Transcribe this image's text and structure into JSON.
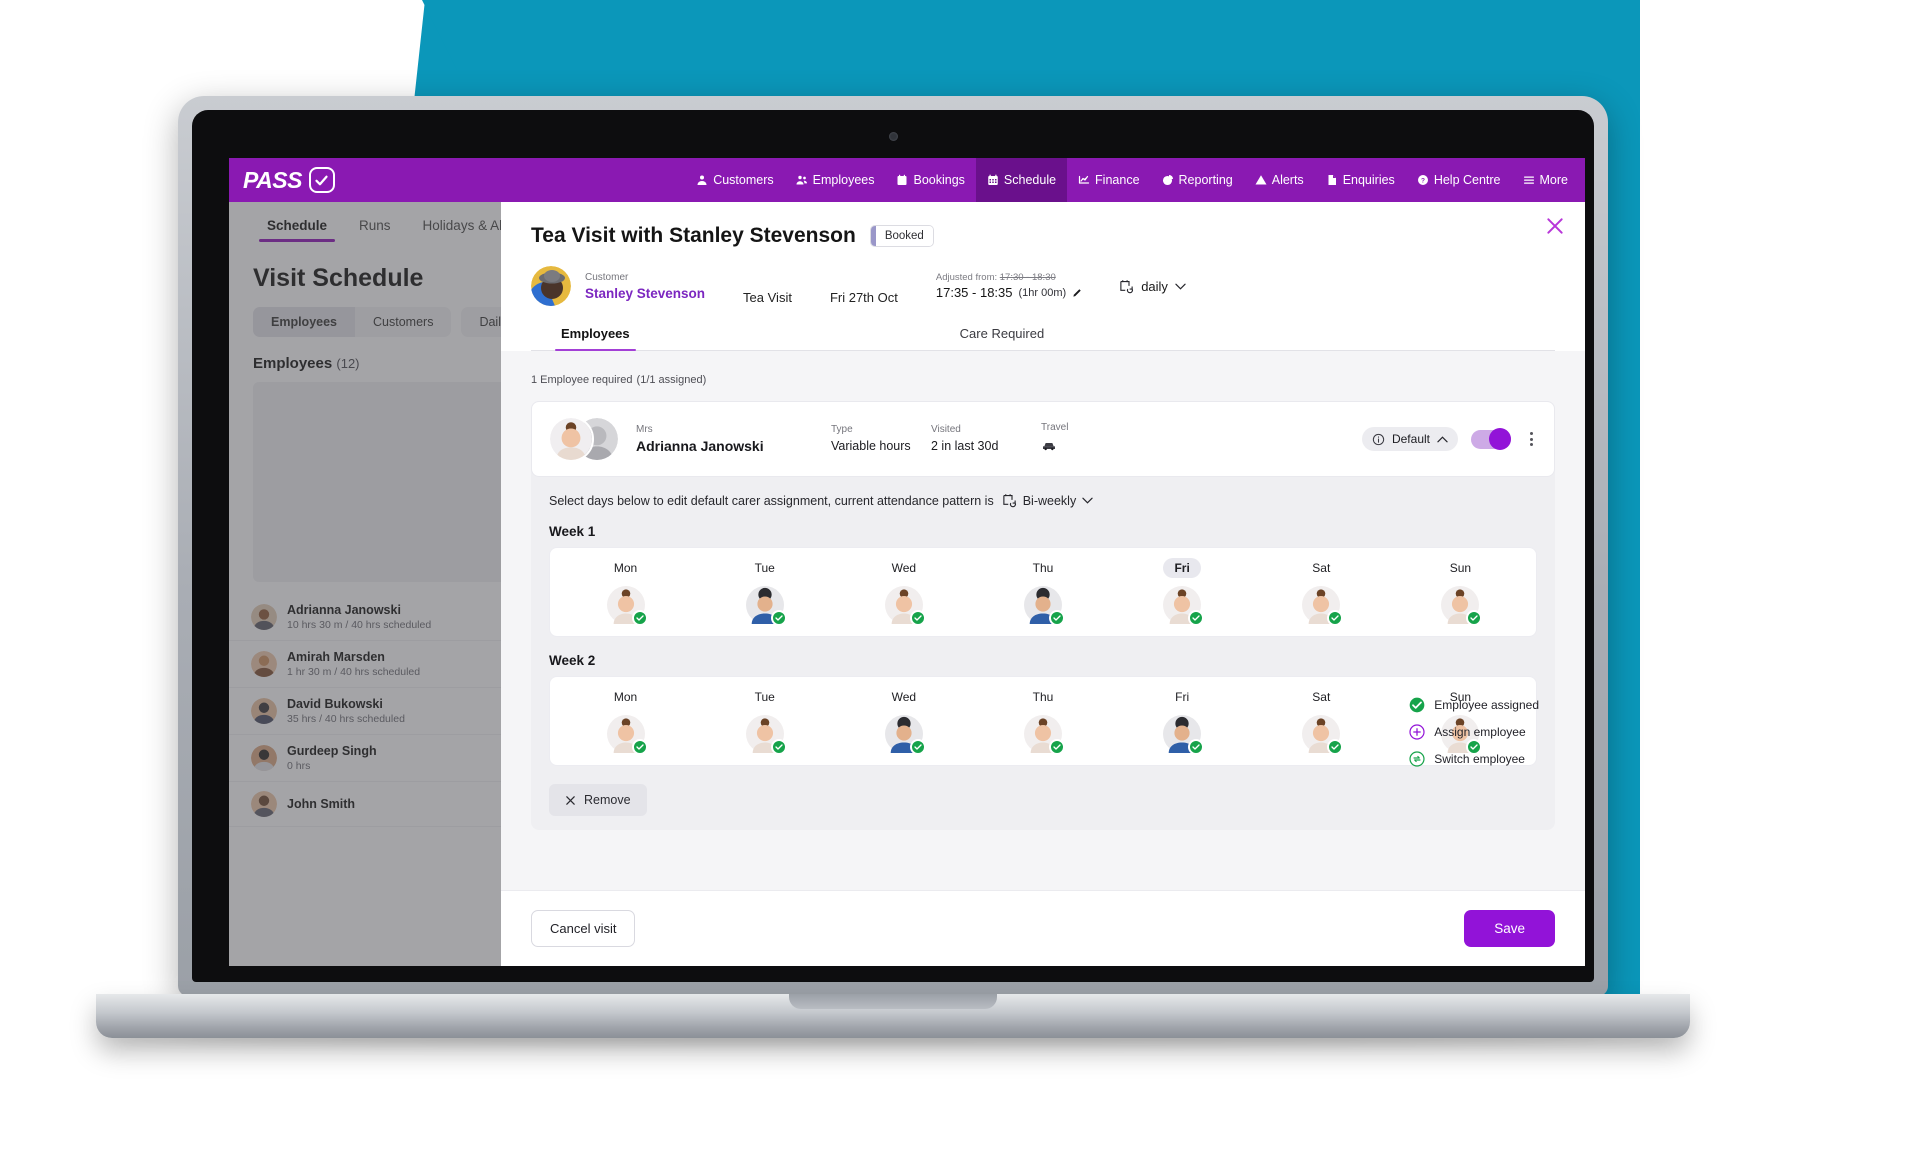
{
  "nav": {
    "logo_text": "PASS",
    "items": [
      {
        "label": "Customers",
        "icon": "user-icon",
        "active": false
      },
      {
        "label": "Employees",
        "icon": "users-icon",
        "active": false
      },
      {
        "label": "Bookings",
        "icon": "calendar-icon",
        "active": false
      },
      {
        "label": "Schedule",
        "icon": "grid-calendar-icon",
        "active": true
      },
      {
        "label": "Finance",
        "icon": "chart-line-icon",
        "active": false
      },
      {
        "label": "Reporting",
        "icon": "pie-chart-icon",
        "active": false
      },
      {
        "label": "Alerts",
        "icon": "warning-triangle-icon",
        "active": false
      },
      {
        "label": "Enquiries",
        "icon": "document-icon",
        "active": false
      },
      {
        "label": "Help Centre",
        "icon": "question-circle-icon",
        "active": false
      },
      {
        "label": "More",
        "icon": "hamburger-icon",
        "active": false
      }
    ]
  },
  "background_app": {
    "subtabs": [
      {
        "label": "Schedule",
        "active": true
      },
      {
        "label": "Runs",
        "active": false
      },
      {
        "label": "Holidays & Ab",
        "active": false
      }
    ],
    "page_title": "Visit Schedule",
    "filters": [
      {
        "label": "Employees",
        "on": true
      },
      {
        "label": "Customers",
        "on": false
      }
    ],
    "filter_extra": "Dail",
    "employees_heading": "Employees",
    "employees_count": "(12)",
    "employee_rows": [
      {
        "name": "Adrianna Janowski",
        "detail": "10 hrs 30 m / 40 hrs scheduled",
        "warning": false
      },
      {
        "name": "Amirah Marsden",
        "detail": "1 hr 30 m / 40 hrs scheduled",
        "warning": false
      },
      {
        "name": "David Bukowski",
        "detail": "35 hrs / 40 hrs scheduled",
        "warning": false
      },
      {
        "name": "Gurdeep Singh",
        "detail": "0 hrs",
        "warning": true
      },
      {
        "name": "John Smith",
        "detail": "",
        "warning": false
      }
    ]
  },
  "modal": {
    "close_icon": "close-icon",
    "title": "Tea Visit with Stanley Stevenson",
    "status_badge": "Booked",
    "customer": {
      "label": "Customer",
      "name": "Stanley Stevenson",
      "visit_type": "Tea Visit",
      "date": "Fri 27th Oct"
    },
    "adjusted": {
      "prefix": "Adjusted from:",
      "original": "17:30 - 18:30",
      "current": "17:35 - 18:35",
      "duration": "(1hr 00m)",
      "edit_icon": "pencil-icon"
    },
    "recurrence": {
      "value": "daily",
      "icon": "repeat-calendar-icon"
    },
    "tabs": [
      {
        "label": "Employees",
        "active": true
      },
      {
        "label": "Care Required",
        "active": false
      }
    ],
    "requirement": {
      "heading": "1 Employee required",
      "assigned": "(1/1 assigned)"
    },
    "employee_card": {
      "title_label": "Mrs",
      "name": "Adrianna Janowski",
      "type_label": "Type",
      "type_value": "Variable hours",
      "visited_label": "Visited",
      "visited_value": "2 in last 30d",
      "travel_label": "Travel",
      "travel_icon": "car-icon",
      "default_label": "Default",
      "info_icon": "info-circle-icon",
      "chevron_icon": "chevron-up-icon",
      "toggle_on": true,
      "menu_icon": "kebab-menu-icon"
    },
    "pattern": {
      "text": "Select days below to edit default carer assignment, current attendance pattern is",
      "value": "Bi-weekly",
      "icon": "repeat-calendar-icon"
    },
    "weeks": [
      {
        "label": "Week 1",
        "days": [
          {
            "name": "Mon",
            "selected": false,
            "state": "assigned",
            "face": "f1"
          },
          {
            "name": "Tue",
            "selected": false,
            "state": "assigned",
            "face": "m1"
          },
          {
            "name": "Wed",
            "selected": false,
            "state": "assigned",
            "face": "f1"
          },
          {
            "name": "Thu",
            "selected": false,
            "state": "assigned",
            "face": "m1"
          },
          {
            "name": "Fri",
            "selected": true,
            "state": "assigned",
            "face": "f1"
          },
          {
            "name": "Sat",
            "selected": false,
            "state": "assigned",
            "face": "f1"
          },
          {
            "name": "Sun",
            "selected": false,
            "state": "assigned",
            "face": "f1"
          }
        ]
      },
      {
        "label": "Week 2",
        "days": [
          {
            "name": "Mon",
            "selected": false,
            "state": "assigned",
            "face": "f1"
          },
          {
            "name": "Tue",
            "selected": false,
            "state": "assigned",
            "face": "f1"
          },
          {
            "name": "Wed",
            "selected": false,
            "state": "assigned",
            "face": "m1"
          },
          {
            "name": "Thu",
            "selected": false,
            "state": "assigned",
            "face": "f1"
          },
          {
            "name": "Fri",
            "selected": false,
            "state": "assigned",
            "face": "m1"
          },
          {
            "name": "Sat",
            "selected": false,
            "state": "assigned",
            "face": "f1"
          },
          {
            "name": "Sun",
            "selected": false,
            "state": "assigned",
            "face": "f1"
          }
        ]
      }
    ],
    "legend": [
      {
        "label": "Employee assigned",
        "icon": "check-circle-filled-icon",
        "color": "#16a34a"
      },
      {
        "label": "Assign employee",
        "icon": "plus-circle-icon",
        "color": "#9213d8"
      },
      {
        "label": "Switch employee",
        "icon": "switch-circle-icon",
        "color": "#16a34a"
      }
    ],
    "remove_button": {
      "label": "Remove",
      "icon": "close-icon"
    },
    "footer": {
      "cancel_label": "Cancel visit",
      "save_label": "Save"
    }
  },
  "colors": {
    "brand_purple": "#8a19b2",
    "accent_purple": "#9213d8",
    "teal": "#0b97ba",
    "green": "#16a34a"
  }
}
